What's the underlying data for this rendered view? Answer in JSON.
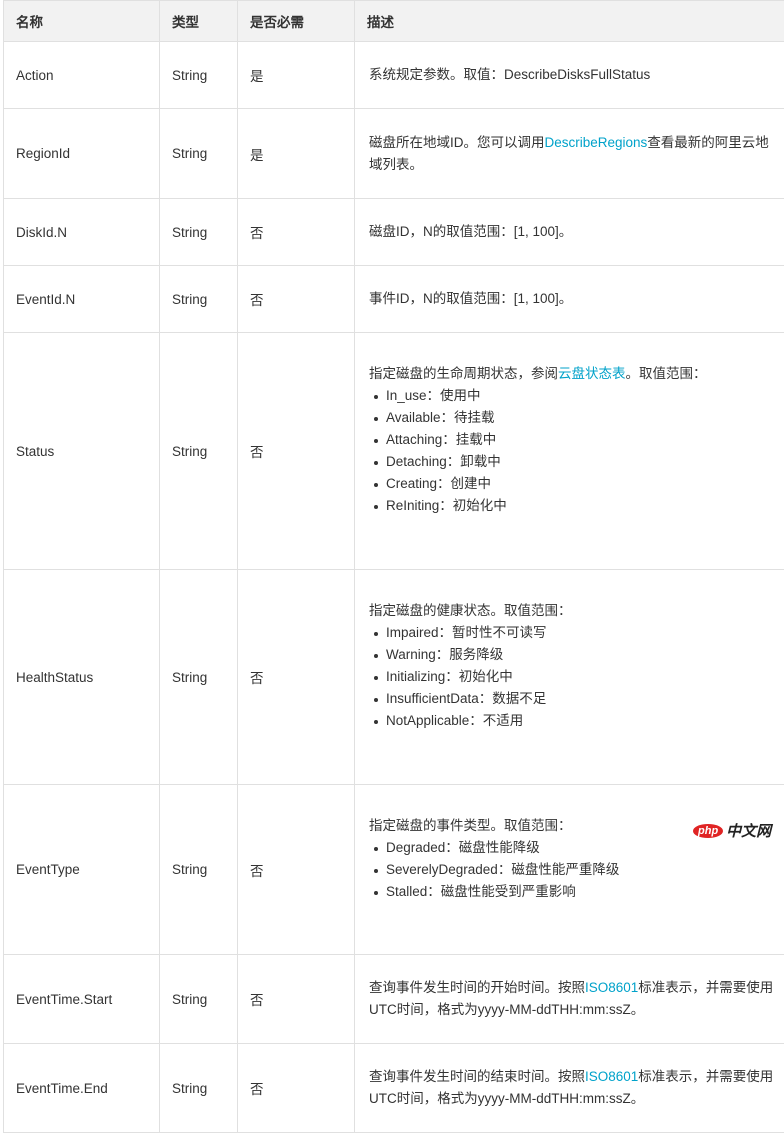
{
  "table": {
    "headers": [
      "名称",
      "类型",
      "是否必需",
      "描述"
    ],
    "rows": [
      {
        "name": "Action",
        "type": "String",
        "required": "是",
        "desc_pre": "系统规定参数。取值：DescribeDisksFullStatus",
        "desc_link": "",
        "desc_post": "",
        "items": []
      },
      {
        "name": "RegionId",
        "type": "String",
        "required": "是",
        "desc_pre": "磁盘所在地域ID。您可以调用",
        "desc_link": "DescribeRegions",
        "desc_post": "查看最新的阿里云地域列表。",
        "items": []
      },
      {
        "name": "DiskId.N",
        "type": "String",
        "required": "否",
        "desc_pre": "磁盘ID，N的取值范围：[1, 100]。",
        "desc_link": "",
        "desc_post": "",
        "items": []
      },
      {
        "name": "EventId.N",
        "type": "String",
        "required": "否",
        "desc_pre": "事件ID，N的取值范围：[1, 100]。",
        "desc_link": "",
        "desc_post": "",
        "items": []
      },
      {
        "name": "Status",
        "type": "String",
        "required": "否",
        "desc_pre": "指定磁盘的生命周期状态，参阅",
        "desc_link": "云盘状态表",
        "desc_post": "。取值范围：",
        "items": [
          "In_use：使用中",
          "Available：待挂载",
          "Attaching：挂载中",
          "Detaching：卸载中",
          "Creating：创建中",
          "ReIniting：初始化中"
        ]
      },
      {
        "name": "HealthStatus",
        "type": "String",
        "required": "否",
        "desc_pre": "指定磁盘的健康状态。取值范围：",
        "desc_link": "",
        "desc_post": "",
        "items": [
          "Impaired：暂时性不可读写",
          "Warning：服务降级",
          "Initializing：初始化中",
          "InsufficientData：数据不足",
          "NotApplicable：不适用"
        ]
      },
      {
        "name": "EventType",
        "type": "String",
        "required": "否",
        "desc_pre": "指定磁盘的事件类型。取值范围：",
        "desc_link": "",
        "desc_post": "",
        "items": [
          "Degraded：磁盘性能降级",
          "SeverelyDegraded：磁盘性能严重降级",
          "Stalled：磁盘性能受到严重影响"
        ]
      },
      {
        "name": "EventTime.Start",
        "type": "String",
        "required": "否",
        "desc_pre": "查询事件发生时间的开始时间。按照",
        "desc_link": "ISO8601",
        "desc_post": "标准表示，并需要使用UTC时间，格式为yyyy-MM-ddTHH:mm:ssZ。",
        "items": []
      },
      {
        "name": "EventTime.End",
        "type": "String",
        "required": "否",
        "desc_pre": "查询事件发生时间的结束时间。按照",
        "desc_link": "ISO8601",
        "desc_post": "标准表示，并需要使用UTC时间，格式为yyyy-MM-ddTHH:mm:ssZ。",
        "items": []
      }
    ]
  },
  "watermark": {
    "brand": "php",
    "text": "中文网"
  },
  "colors": {
    "link": "#00a2ca",
    "header_bg": "#f2f2f2",
    "border": "#e0e0e0"
  }
}
